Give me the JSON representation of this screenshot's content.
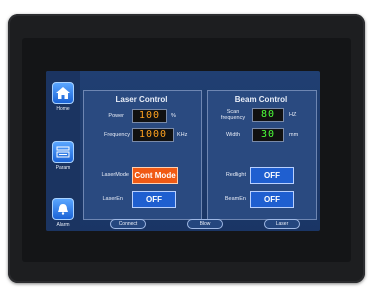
{
  "sidebar": {
    "items": [
      {
        "label": "Home",
        "icon": "home-icon"
      },
      {
        "label": "Param",
        "icon": "param-icon"
      },
      {
        "label": "Alarm",
        "icon": "alarm-icon"
      }
    ]
  },
  "laser_control": {
    "title": "Laser Control",
    "power_label": "Power",
    "power_value": "100",
    "power_unit": "%",
    "frequency_label": "Frequency",
    "frequency_value": "1000",
    "frequency_unit": "KHz",
    "lasermode_label": "LaserMode",
    "lasermode_value": "Cont Mode",
    "laseren_label": "LaserEn",
    "laseren_value": "OFF"
  },
  "beam_control": {
    "title": "Beam Control",
    "scan_freq_label": "Scan frequency",
    "scan_freq_value": "80",
    "scan_freq_unit": "HZ",
    "width_label": "Width",
    "width_value": "30",
    "width_unit": "mm",
    "redlight_label": "Redlight",
    "redlight_value": "OFF",
    "beamen_label": "BeamEn",
    "beamen_value": "OFF"
  },
  "footer": {
    "connect": "Connect",
    "blow": "Blow",
    "laser": "Laser"
  },
  "colors": {
    "screen_bg": "#1f3c6e",
    "orange_readout": "#ffa21f",
    "green_readout": "#4cff3a",
    "button_blue": "#1f5fd0",
    "mode_orange": "#f05a14"
  }
}
